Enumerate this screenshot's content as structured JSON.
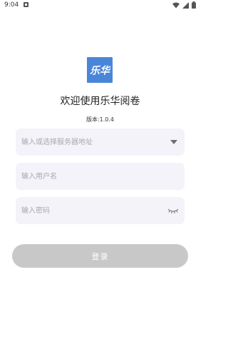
{
  "status_bar": {
    "time": "9:04"
  },
  "logo": {
    "text": "乐华",
    "color": "#4a86d8"
  },
  "welcome": {
    "title": "欢迎使用乐华阅卷",
    "version": "版本:1.0.4"
  },
  "form": {
    "server_placeholder": "输入或选择服务器地址",
    "server_value": "",
    "username_placeholder": "输入用户名",
    "username_value": "",
    "password_placeholder": "输入密码",
    "password_value": ""
  },
  "login_button": {
    "label": "登录",
    "color": "#c8c8c8"
  },
  "icons": {
    "notification": "notification-icon",
    "wifi": "wifi-icon",
    "signal": "signal-icon",
    "battery": "battery-icon",
    "dropdown": "dropdown-arrow-icon",
    "password_visibility": "eye-closed-icon"
  }
}
